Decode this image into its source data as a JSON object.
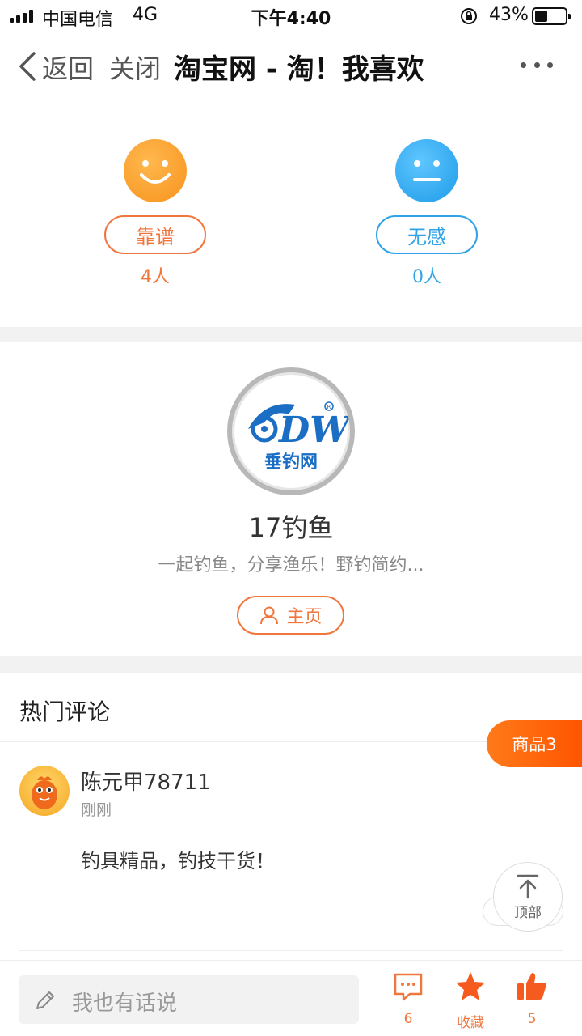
{
  "status_bar": {
    "carrier": "中国电信",
    "network": "4G",
    "time": "下午4:40",
    "battery": "43%",
    "battery_level": 0.43
  },
  "nav": {
    "back": "返回",
    "close": "关闭",
    "title": "淘宝网 - 淘！我喜欢"
  },
  "rating": {
    "reliable": {
      "label": "靠谱",
      "count": "4人"
    },
    "meh": {
      "label": "无感",
      "count": "0人"
    }
  },
  "profile": {
    "logo_text": "垂钓网",
    "name": "17钓鱼",
    "description": "一起钓鱼，分享渔乐！野钓简约...",
    "home_button": "主页"
  },
  "comments": {
    "title": "热门评论",
    "items": [
      {
        "user": "陈元甲78711",
        "time": "刚刚",
        "text": "钓具精品，钓技干货！"
      }
    ]
  },
  "floating": {
    "goods": "商品3",
    "top": "顶部"
  },
  "bottom_bar": {
    "input_placeholder": "我也有话说",
    "comment_count": "6",
    "favorite_label": "收藏",
    "like_count": "5"
  },
  "colors": {
    "accent_orange": "#f0763c",
    "accent_blue": "#2fa3e6"
  }
}
